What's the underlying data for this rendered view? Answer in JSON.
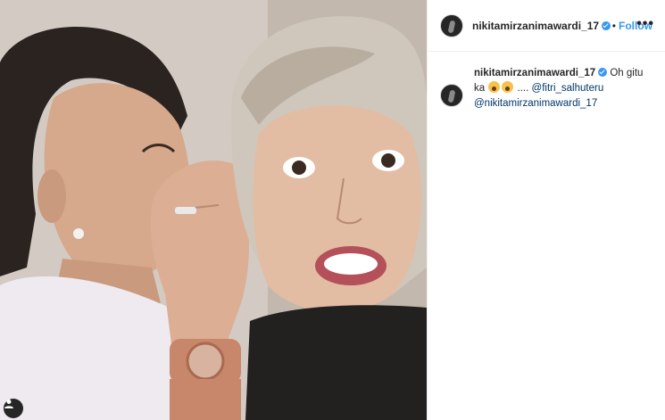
{
  "post": {
    "header": {
      "username": "nikitamirzanimawardi_17",
      "separator": "•",
      "follow_label": "Follow",
      "more_label": "•••"
    },
    "caption": {
      "username": "nikitamirzanimawardi_17",
      "text": " Oh gitu ka ",
      "ellipsis": " .... ",
      "mention_1": "@fitri_salhuteru",
      "mention_2": "@nikitamirzanimawardi_17"
    },
    "photo": {
      "tag_icon": "user-tag-icon"
    }
  },
  "colors": {
    "accent": "#3897f0",
    "mention": "#003569",
    "text": "#262626",
    "border": "#efefef"
  }
}
